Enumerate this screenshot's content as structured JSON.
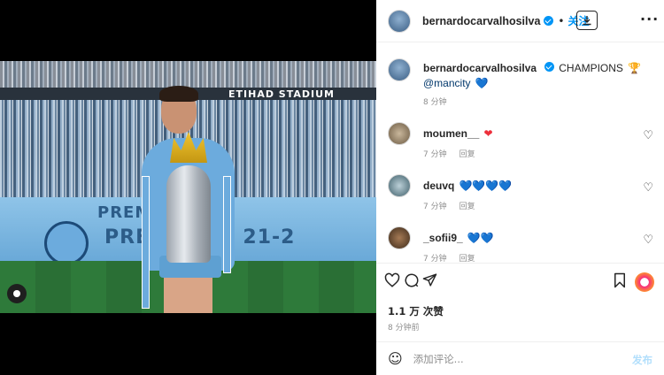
{
  "photo": {
    "stadium_text": "ETIHAD STADIUM",
    "board_text_1": "PREM",
    "board_text_2": "PRE  EAGUE 21-2"
  },
  "header": {
    "username": "bernardocarvalhosilva",
    "dot": "•",
    "follow_label": "关注",
    "more_label": "···"
  },
  "caption": {
    "username": "bernardocarvalhosilva",
    "text": "CHAMPIONS",
    "trophy_emoji": "🏆",
    "mention": "@mancity",
    "heart": "💙",
    "time": "8 分钟"
  },
  "comments": [
    {
      "username": "moumen__",
      "text": "",
      "emoji": "❤",
      "emoji_color": "red",
      "time": "7 分钟",
      "reply": "回复"
    },
    {
      "username": "deuvq",
      "text": "",
      "emoji": "💙💙💙💙",
      "emoji_color": "blue",
      "time": "7 分钟",
      "reply": "回复"
    },
    {
      "username": "_sofii9_",
      "text": "",
      "emoji": "💙💙",
      "emoji_color": "blue",
      "time": "7 分钟",
      "reply": "回复"
    }
  ],
  "likes": "1.1 万 次赞",
  "time_ago": "8 分钟前",
  "comment_box": {
    "placeholder": "添加评论...",
    "post_label": "发布"
  },
  "colors": {
    "accent": "#0095f6",
    "muted": "#8e8e8e"
  }
}
